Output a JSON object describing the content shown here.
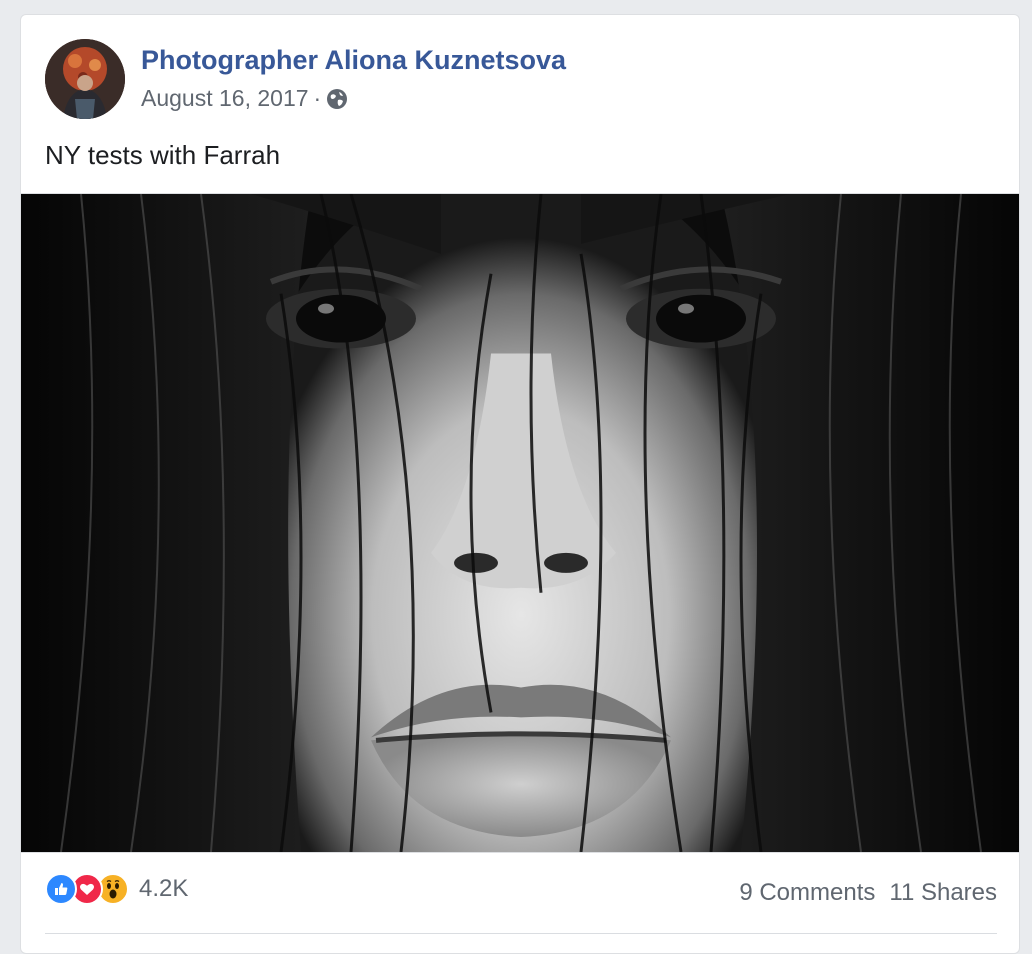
{
  "post": {
    "author": "Photographer Aliona Kuznetsova",
    "date": "August 16, 2017",
    "separator": "·",
    "privacy_icon": "globe-icon",
    "text": "NY tests with Farrah"
  },
  "photo": {
    "style": "black-and-white close-up portrait"
  },
  "stats": {
    "reaction_icons": [
      "like-icon",
      "love-icon",
      "wow-icon"
    ],
    "reactions_count": "4.2K",
    "comments": "9 Comments",
    "shares": "11 Shares"
  },
  "colors": {
    "author_link": "#385898",
    "secondary_text": "#606770",
    "like": "#2d88ff",
    "love": "#f02849",
    "wow": "#f7b125"
  }
}
